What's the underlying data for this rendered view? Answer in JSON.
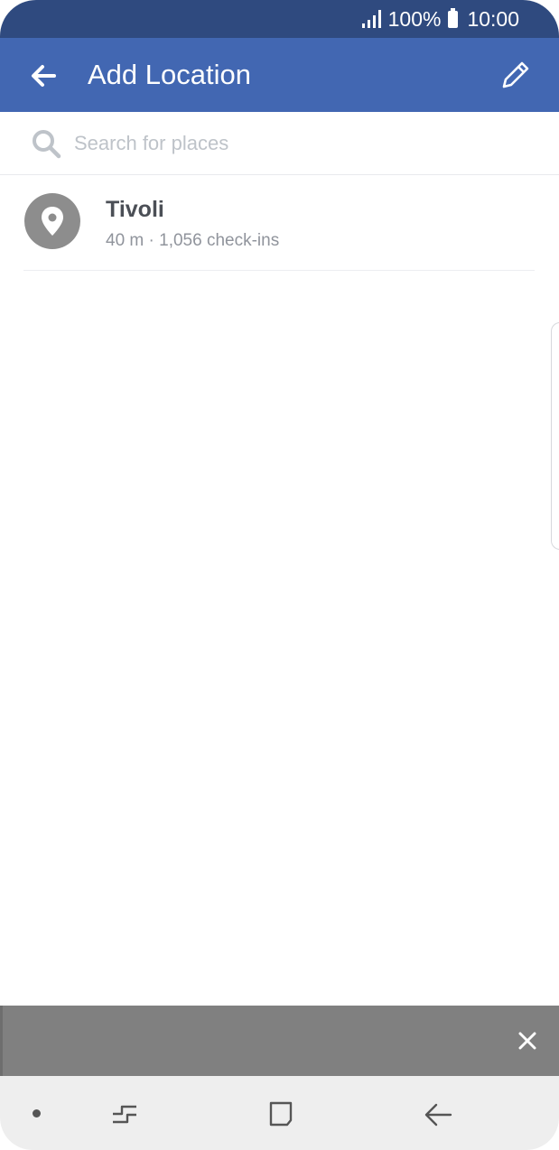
{
  "status_bar": {
    "battery": "100%",
    "time": "10:00"
  },
  "app_bar": {
    "title": "Add Location",
    "back_icon": "arrow-left-icon",
    "edit_icon": "pencil-icon"
  },
  "search": {
    "placeholder": "Search for places",
    "value": ""
  },
  "places": [
    {
      "name": "Tivoli",
      "meta": "40 m · 1,056 check-ins",
      "icon": "map-pin-icon"
    }
  ],
  "colors": {
    "status_bar": "#2f4a7f",
    "app_bar": "#4267b2",
    "banner": "#808080",
    "nav_bar": "#eeeeee"
  }
}
